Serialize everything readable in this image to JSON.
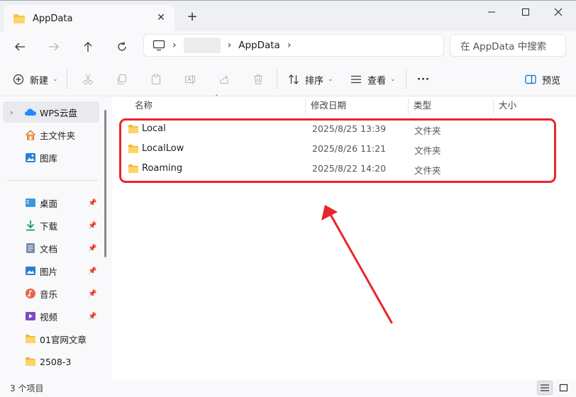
{
  "window": {
    "tab_title": "AppData",
    "tab_icon": "folder-icon",
    "new_tab_symbol": "+"
  },
  "address": {
    "crumbs": [
      "AppData"
    ],
    "search_placeholder": "在 AppData 中搜索"
  },
  "toolbar": {
    "new_label": "新建",
    "sort_label": "排序",
    "view_label": "查看",
    "more_label": "···",
    "preview_label": "预览"
  },
  "sidebar": {
    "top_items": [
      {
        "label": "WPS云盘",
        "icon": "cloud-icon"
      },
      {
        "label": "主文件夹",
        "icon": "home-icon"
      },
      {
        "label": "图库",
        "icon": "gallery-icon"
      }
    ],
    "quick_items": [
      {
        "label": "桌面",
        "icon": "desktop-icon",
        "pinned": true
      },
      {
        "label": "下载",
        "icon": "download-icon",
        "pinned": true
      },
      {
        "label": "文档",
        "icon": "document-icon",
        "pinned": true
      },
      {
        "label": "图片",
        "icon": "picture-icon",
        "pinned": true
      },
      {
        "label": "音乐",
        "icon": "music-icon",
        "pinned": true
      },
      {
        "label": "视频",
        "icon": "video-icon",
        "pinned": true
      },
      {
        "label": "01官网文章",
        "icon": "folder-icon",
        "pinned": false
      },
      {
        "label": "2508-3",
        "icon": "folder-icon",
        "pinned": false
      }
    ]
  },
  "columns": [
    "名称",
    "修改日期",
    "类型",
    "大小"
  ],
  "files": [
    {
      "name": "Local",
      "date": "2025/8/25 13:39",
      "type": "文件夹"
    },
    {
      "name": "LocalLow",
      "date": "2025/8/26 11:21",
      "type": "文件夹"
    },
    {
      "name": "Roaming",
      "date": "2025/8/22 14:20",
      "type": "文件夹"
    }
  ],
  "status": {
    "item_count": "3 个项目"
  },
  "colors": {
    "highlight": "#e8262a",
    "folder": "#f7c24a",
    "accent": "#0067c0"
  }
}
